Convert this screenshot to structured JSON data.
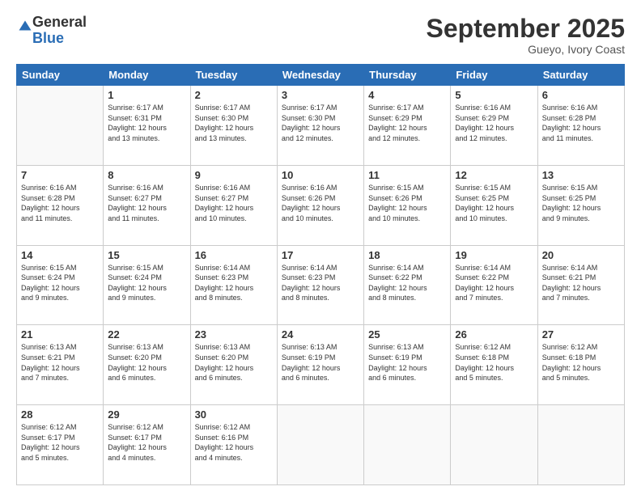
{
  "header": {
    "logo_general": "General",
    "logo_blue": "Blue",
    "month_title": "September 2025",
    "location": "Gueyo, Ivory Coast"
  },
  "days_of_week": [
    "Sunday",
    "Monday",
    "Tuesday",
    "Wednesday",
    "Thursday",
    "Friday",
    "Saturday"
  ],
  "weeks": [
    [
      {
        "day": "",
        "info": ""
      },
      {
        "day": "1",
        "info": "Sunrise: 6:17 AM\nSunset: 6:31 PM\nDaylight: 12 hours\nand 13 minutes."
      },
      {
        "day": "2",
        "info": "Sunrise: 6:17 AM\nSunset: 6:30 PM\nDaylight: 12 hours\nand 13 minutes."
      },
      {
        "day": "3",
        "info": "Sunrise: 6:17 AM\nSunset: 6:30 PM\nDaylight: 12 hours\nand 12 minutes."
      },
      {
        "day": "4",
        "info": "Sunrise: 6:17 AM\nSunset: 6:29 PM\nDaylight: 12 hours\nand 12 minutes."
      },
      {
        "day": "5",
        "info": "Sunrise: 6:16 AM\nSunset: 6:29 PM\nDaylight: 12 hours\nand 12 minutes."
      },
      {
        "day": "6",
        "info": "Sunrise: 6:16 AM\nSunset: 6:28 PM\nDaylight: 12 hours\nand 11 minutes."
      }
    ],
    [
      {
        "day": "7",
        "info": "Sunrise: 6:16 AM\nSunset: 6:28 PM\nDaylight: 12 hours\nand 11 minutes."
      },
      {
        "day": "8",
        "info": "Sunrise: 6:16 AM\nSunset: 6:27 PM\nDaylight: 12 hours\nand 11 minutes."
      },
      {
        "day": "9",
        "info": "Sunrise: 6:16 AM\nSunset: 6:27 PM\nDaylight: 12 hours\nand 10 minutes."
      },
      {
        "day": "10",
        "info": "Sunrise: 6:16 AM\nSunset: 6:26 PM\nDaylight: 12 hours\nand 10 minutes."
      },
      {
        "day": "11",
        "info": "Sunrise: 6:15 AM\nSunset: 6:26 PM\nDaylight: 12 hours\nand 10 minutes."
      },
      {
        "day": "12",
        "info": "Sunrise: 6:15 AM\nSunset: 6:25 PM\nDaylight: 12 hours\nand 10 minutes."
      },
      {
        "day": "13",
        "info": "Sunrise: 6:15 AM\nSunset: 6:25 PM\nDaylight: 12 hours\nand 9 minutes."
      }
    ],
    [
      {
        "day": "14",
        "info": "Sunrise: 6:15 AM\nSunset: 6:24 PM\nDaylight: 12 hours\nand 9 minutes."
      },
      {
        "day": "15",
        "info": "Sunrise: 6:15 AM\nSunset: 6:24 PM\nDaylight: 12 hours\nand 9 minutes."
      },
      {
        "day": "16",
        "info": "Sunrise: 6:14 AM\nSunset: 6:23 PM\nDaylight: 12 hours\nand 8 minutes."
      },
      {
        "day": "17",
        "info": "Sunrise: 6:14 AM\nSunset: 6:23 PM\nDaylight: 12 hours\nand 8 minutes."
      },
      {
        "day": "18",
        "info": "Sunrise: 6:14 AM\nSunset: 6:22 PM\nDaylight: 12 hours\nand 8 minutes."
      },
      {
        "day": "19",
        "info": "Sunrise: 6:14 AM\nSunset: 6:22 PM\nDaylight: 12 hours\nand 7 minutes."
      },
      {
        "day": "20",
        "info": "Sunrise: 6:14 AM\nSunset: 6:21 PM\nDaylight: 12 hours\nand 7 minutes."
      }
    ],
    [
      {
        "day": "21",
        "info": "Sunrise: 6:13 AM\nSunset: 6:21 PM\nDaylight: 12 hours\nand 7 minutes."
      },
      {
        "day": "22",
        "info": "Sunrise: 6:13 AM\nSunset: 6:20 PM\nDaylight: 12 hours\nand 6 minutes."
      },
      {
        "day": "23",
        "info": "Sunrise: 6:13 AM\nSunset: 6:20 PM\nDaylight: 12 hours\nand 6 minutes."
      },
      {
        "day": "24",
        "info": "Sunrise: 6:13 AM\nSunset: 6:19 PM\nDaylight: 12 hours\nand 6 minutes."
      },
      {
        "day": "25",
        "info": "Sunrise: 6:13 AM\nSunset: 6:19 PM\nDaylight: 12 hours\nand 6 minutes."
      },
      {
        "day": "26",
        "info": "Sunrise: 6:12 AM\nSunset: 6:18 PM\nDaylight: 12 hours\nand 5 minutes."
      },
      {
        "day": "27",
        "info": "Sunrise: 6:12 AM\nSunset: 6:18 PM\nDaylight: 12 hours\nand 5 minutes."
      }
    ],
    [
      {
        "day": "28",
        "info": "Sunrise: 6:12 AM\nSunset: 6:17 PM\nDaylight: 12 hours\nand 5 minutes."
      },
      {
        "day": "29",
        "info": "Sunrise: 6:12 AM\nSunset: 6:17 PM\nDaylight: 12 hours\nand 4 minutes."
      },
      {
        "day": "30",
        "info": "Sunrise: 6:12 AM\nSunset: 6:16 PM\nDaylight: 12 hours\nand 4 minutes."
      },
      {
        "day": "",
        "info": ""
      },
      {
        "day": "",
        "info": ""
      },
      {
        "day": "",
        "info": ""
      },
      {
        "day": "",
        "info": ""
      }
    ]
  ]
}
